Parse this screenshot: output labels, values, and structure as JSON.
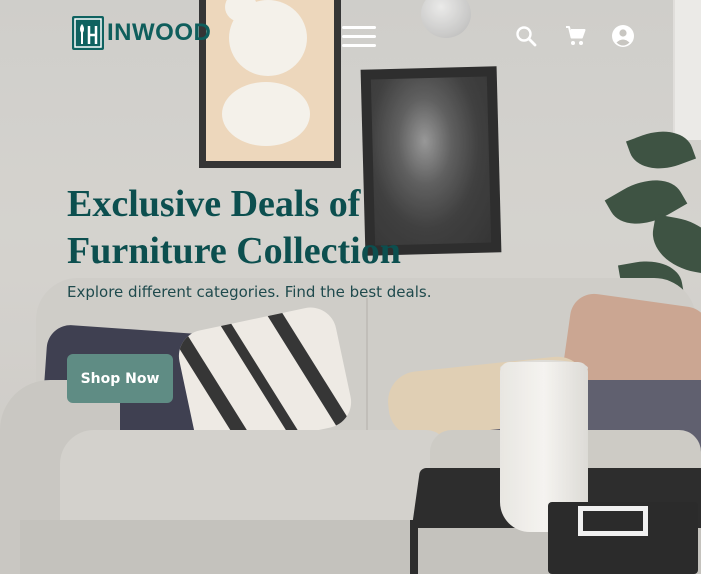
{
  "brand": {
    "logo_text": "INWOOD",
    "color": "#0f5e5c"
  },
  "nav": {
    "menu_icon": "hamburger-menu-icon",
    "search_icon": "search-icon",
    "cart_icon": "shopping-cart-icon",
    "account_icon": "account-circle-icon"
  },
  "hero": {
    "headline_line1": "Exclusive Deals of",
    "headline_line2": "Furniture Collection",
    "subtitle": "Explore different categories. Find the best deals.",
    "cta_label": "Shop Now",
    "headline_color": "#0c4f4f",
    "cta_color": "#5f8c84"
  }
}
